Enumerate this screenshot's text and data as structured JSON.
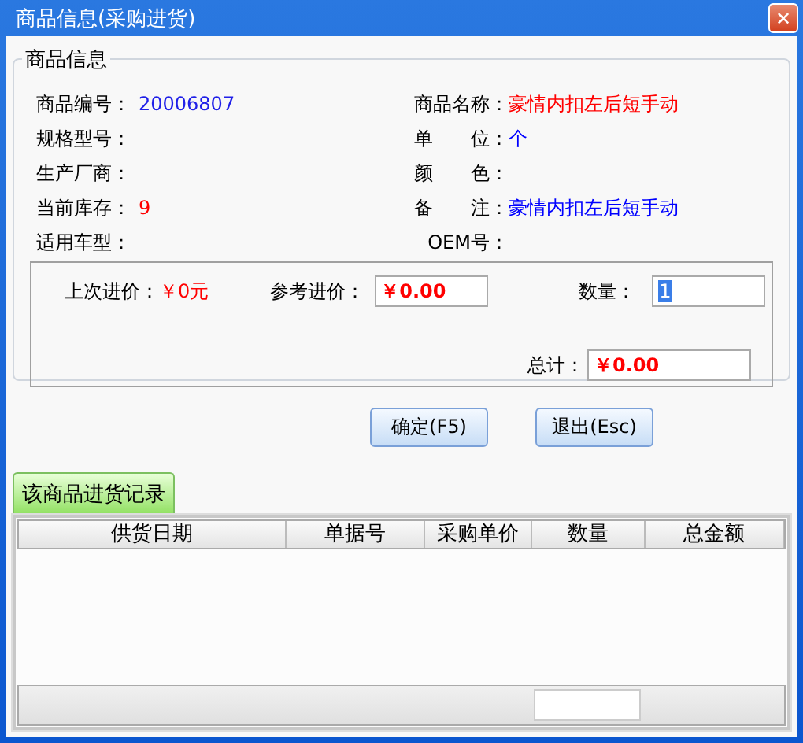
{
  "window": {
    "title": "商品信息(采购进货)",
    "close": "✕"
  },
  "info": {
    "title": "商品信息",
    "fields": [
      {
        "label": "商品编号：",
        "value": "20006807",
        "color": "#2020e8"
      },
      {
        "label": "商品名称：",
        "value": "豪情内扣左后短手动",
        "color": "#ff0000"
      },
      {
        "label": "规格型号："
      },
      {
        "label": "单　　位：",
        "value": "个",
        "color": "#0000ff"
      },
      {
        "label": "生产厂商："
      },
      {
        "label": "颜　　色："
      },
      {
        "label": "当前库存：",
        "value": "9",
        "color": "#ff0000"
      },
      {
        "label": "备　　注：",
        "value": "豪情内扣左后短手动",
        "color": "#0000ff"
      },
      {
        "label": "适用车型："
      },
      {
        "label": "OEM号："
      }
    ]
  },
  "purchase": {
    "last_price_label": "上次进价：",
    "last_price": "￥0元",
    "ref_price_label": "参考进价：",
    "ref_price": "￥0.00",
    "qty_label": "数量：",
    "qty": {
      "value": "1",
      "selected": true
    },
    "total_label": "总计：",
    "total": "￥0.00"
  },
  "buttons": [
    "确定(F5)",
    "退出(Esc)"
  ],
  "tabs": [
    {
      "label": "该商品进货记录",
      "selected": true
    }
  ],
  "table": {
    "columns": [
      "供货日期",
      "单据号",
      "采购单价",
      "数量",
      "总金额"
    ]
  }
}
